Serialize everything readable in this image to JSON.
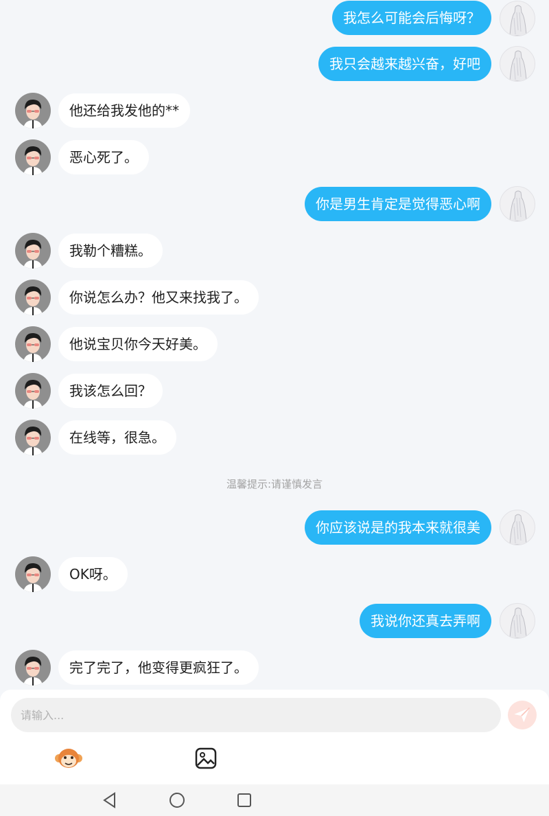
{
  "messages": [
    {
      "side": "me",
      "text": "我怎么可能会后悔呀？"
    },
    {
      "side": "me",
      "text": "我只会越来越兴奋，好吧"
    },
    {
      "side": "them",
      "text": "他还给我发他的**"
    },
    {
      "side": "them",
      "text": "恶心死了。"
    },
    {
      "side": "me",
      "text": "你是男生肯定是觉得恶心啊"
    },
    {
      "side": "them",
      "text": "我勒个糟糕。"
    },
    {
      "side": "them",
      "text": "你说怎么办？他又来找我了。"
    },
    {
      "side": "them",
      "text": "他说宝贝你今天好美。"
    },
    {
      "side": "them",
      "text": "我该怎么回？"
    },
    {
      "side": "them",
      "text": "在线等，很急。"
    },
    {
      "side": "me",
      "text": "你应该说是的我本来就很美"
    },
    {
      "side": "them",
      "text": "OK呀。"
    },
    {
      "side": "me",
      "text": "我说你还真去弄啊"
    },
    {
      "side": "them",
      "text": "完了完了，他变得更疯狂了。"
    }
  ],
  "notice": "温馨提示:请谨慎发言",
  "composer": {
    "placeholder": "请输入...",
    "send_icon": "paper-plane-icon",
    "tools": [
      "monkey-emoji-icon",
      "image-icon"
    ]
  },
  "nav": [
    "back-triangle-icon",
    "home-circle-icon",
    "recents-square-icon"
  ],
  "colors": {
    "my_bubble": "#29b6f6",
    "their_bubble": "#ffffff",
    "background": "#f4f6f9",
    "send_button": "#fde2dd"
  }
}
